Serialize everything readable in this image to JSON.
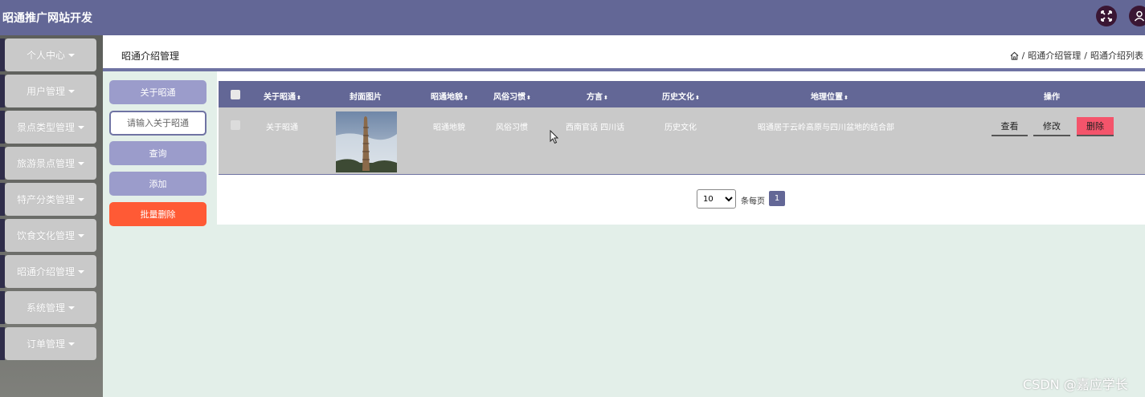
{
  "app": {
    "title": "昭通推广网站开发"
  },
  "sidebar": {
    "items": [
      {
        "label": "个人中心"
      },
      {
        "label": "用户管理"
      },
      {
        "label": "景点类型管理"
      },
      {
        "label": "旅游景点管理"
      },
      {
        "label": "特产分类管理"
      },
      {
        "label": "饮食文化管理"
      },
      {
        "label": "昭通介绍管理"
      },
      {
        "label": "系统管理"
      },
      {
        "label": "订单管理"
      }
    ]
  },
  "page": {
    "title": "昭通介绍管理",
    "breadcrumb": [
      "昭通介绍管理",
      "昭通介绍列表"
    ],
    "breadcrumb_sep": "/"
  },
  "actions": {
    "about_button": "关于昭通",
    "search_placeholder": "请输入关于昭通",
    "query_button": "查询",
    "add_button": "添加",
    "batch_delete_button": "批量删除"
  },
  "table": {
    "headers": [
      {
        "label": "关于昭通",
        "sortable": true
      },
      {
        "label": "封面图片",
        "sortable": false
      },
      {
        "label": "昭通地貌",
        "sortable": true
      },
      {
        "label": "风俗习惯",
        "sortable": true
      },
      {
        "label": "方言",
        "sortable": true
      },
      {
        "label": "历史文化",
        "sortable": true
      },
      {
        "label": "地理位置",
        "sortable": true
      },
      {
        "label": "操作",
        "sortable": false
      }
    ],
    "sort_icon": "⬍",
    "rows": [
      {
        "about": "关于昭通",
        "landform": "昭通地貌",
        "customs": "风俗习惯",
        "dialect": "西南官话 四川话",
        "history": "历史文化",
        "location": "昭通居于云岭高原与四川盆地的结合部",
        "view_label": "查看",
        "edit_label": "修改",
        "delete_label": "删除"
      }
    ]
  },
  "pagination": {
    "page_size": "10",
    "page_size_options": [
      "10"
    ],
    "per_page_label": "条每页",
    "current_page": "1"
  },
  "watermark": "CSDN @嘉应学长",
  "colors": {
    "header": "#636796",
    "primary_button": "#9b9ccb",
    "danger_button": "#ff5a35",
    "row_bg": "#c9c9c9",
    "page_bg": "#e3efe9",
    "delete_row_button": "#f4546b"
  }
}
